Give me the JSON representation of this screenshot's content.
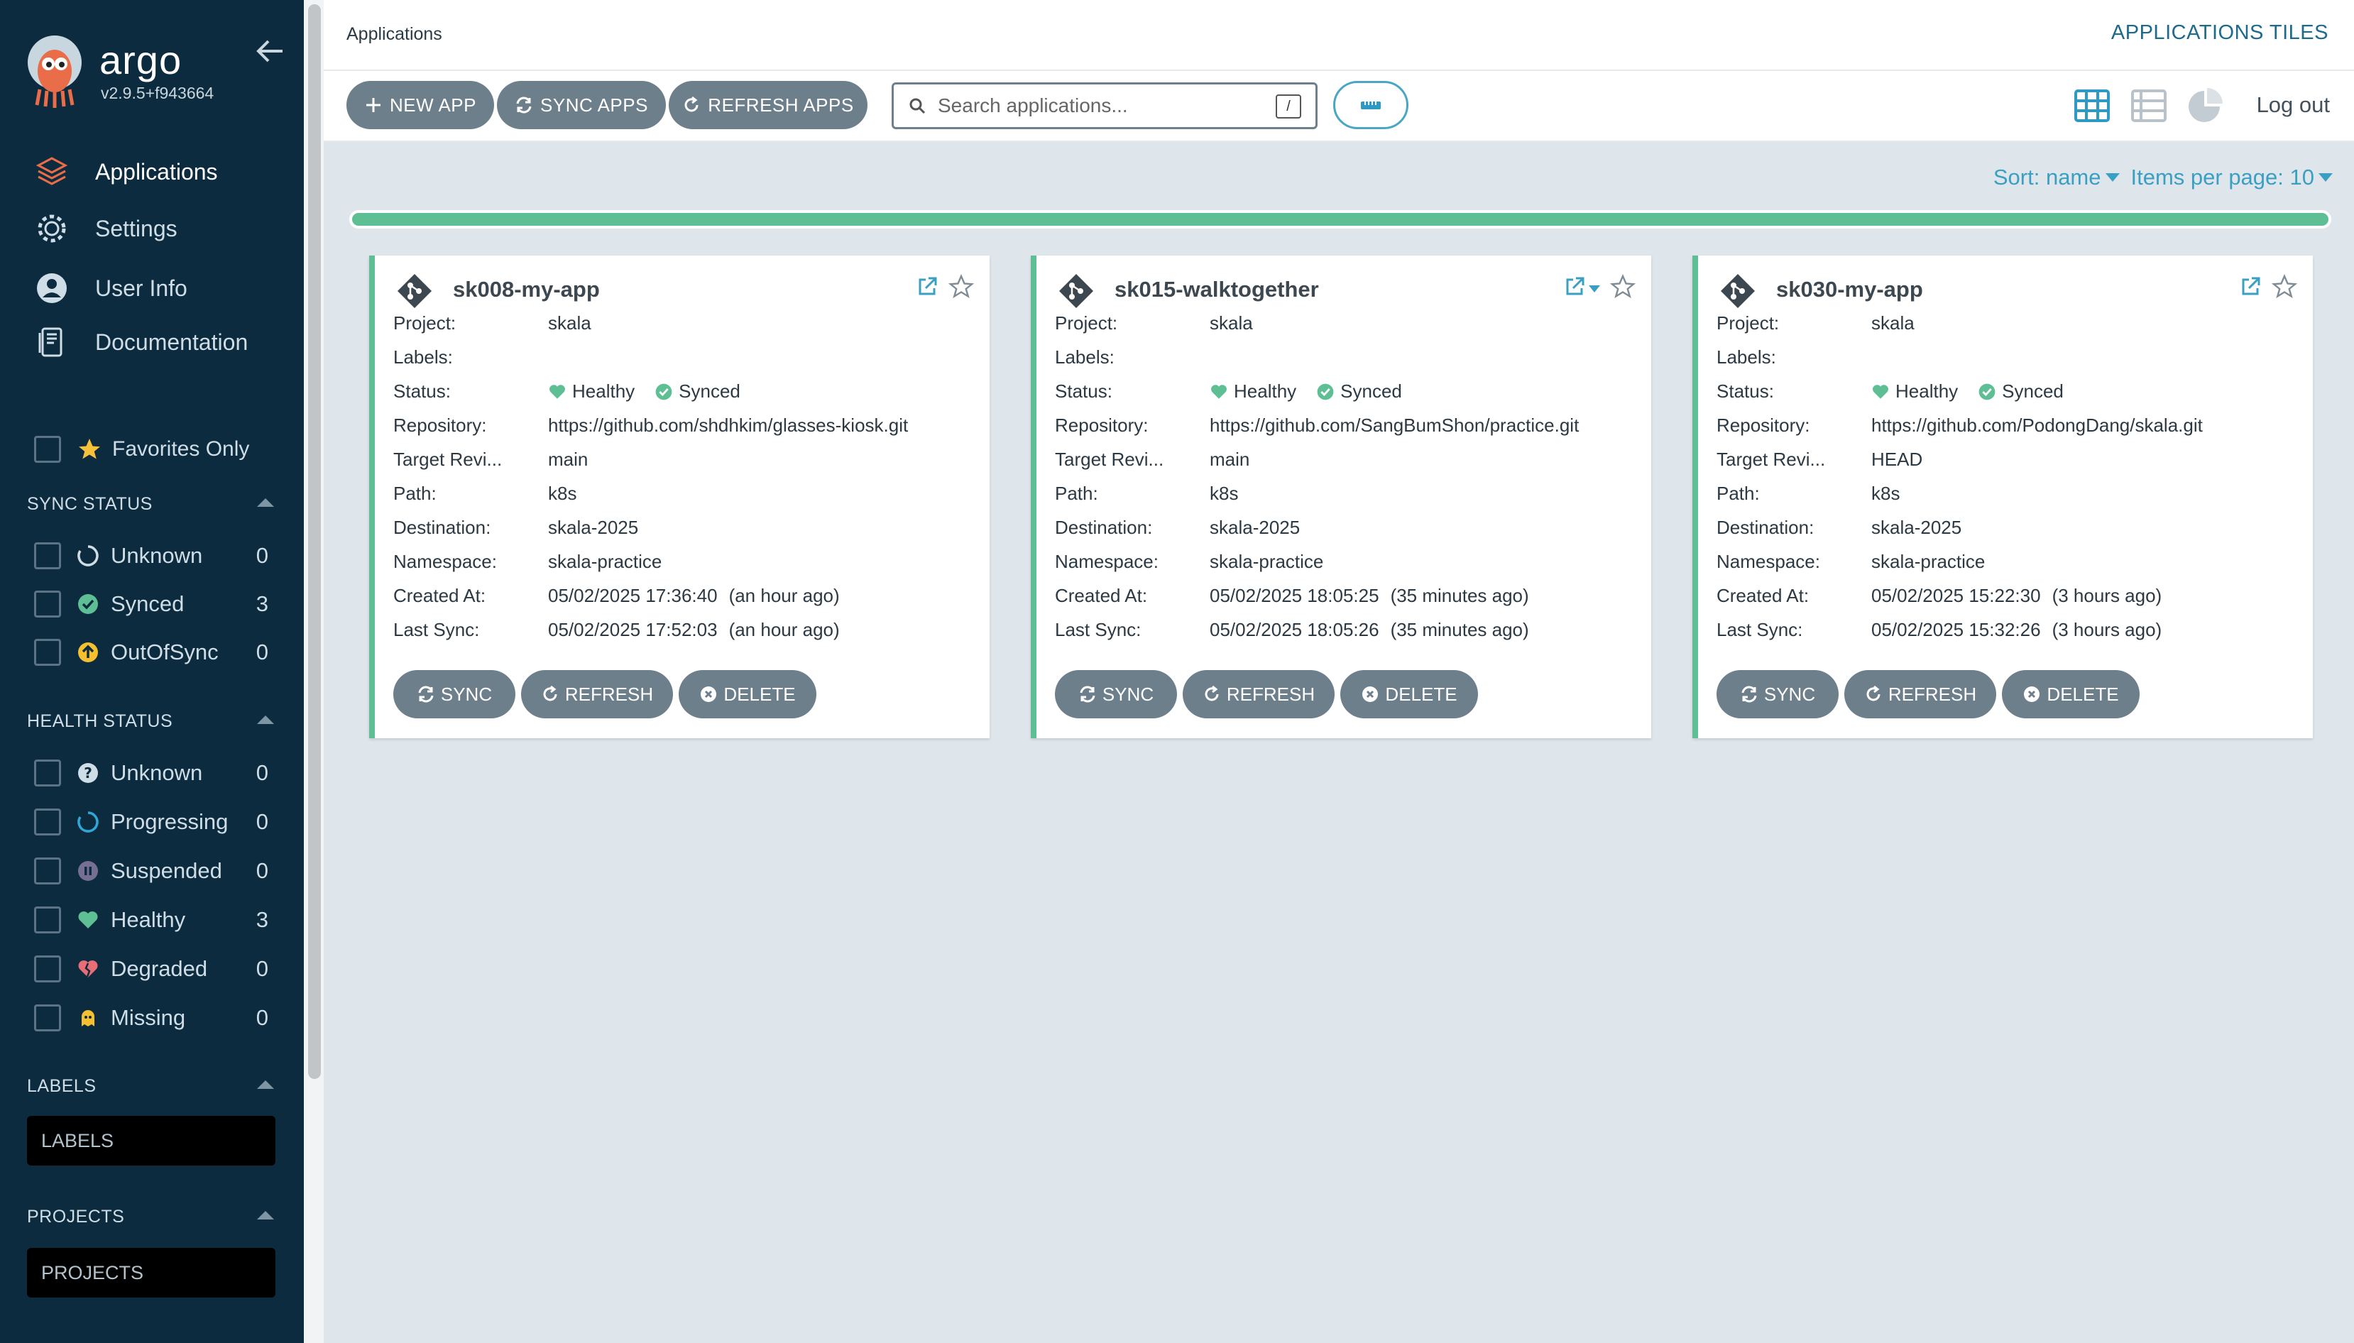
{
  "sidebar": {
    "brand": "argo",
    "version": "v2.9.5+f943664",
    "nav": [
      {
        "label": "Applications",
        "icon": "layers-icon"
      },
      {
        "label": "Settings",
        "icon": "gear-icon"
      },
      {
        "label": "User Info",
        "icon": "user-icon"
      },
      {
        "label": "Documentation",
        "icon": "book-icon"
      }
    ],
    "favorites_label": "Favorites Only",
    "sync_status": {
      "title": "SYNC STATUS",
      "items": [
        {
          "label": "Unknown",
          "count": "0"
        },
        {
          "label": "Synced",
          "count": "3"
        },
        {
          "label": "OutOfSync",
          "count": "0"
        }
      ]
    },
    "health_status": {
      "title": "HEALTH STATUS",
      "items": [
        {
          "label": "Unknown",
          "count": "0"
        },
        {
          "label": "Progressing",
          "count": "0"
        },
        {
          "label": "Suspended",
          "count": "0"
        },
        {
          "label": "Healthy",
          "count": "3"
        },
        {
          "label": "Degraded",
          "count": "0"
        },
        {
          "label": "Missing",
          "count": "0"
        }
      ]
    },
    "labels": {
      "title": "LABELS",
      "placeholder": "LABELS"
    },
    "projects": {
      "title": "PROJECTS",
      "placeholder": "PROJECTS"
    }
  },
  "header": {
    "breadcrumb": "Applications",
    "view_title": "APPLICATIONS TILES",
    "logout": "Log out"
  },
  "toolbar": {
    "new_app": "NEW APP",
    "sync_apps": "SYNC APPS",
    "refresh_apps": "REFRESH APPS",
    "search_placeholder": "Search applications...",
    "search_shortcut": "/"
  },
  "list": {
    "sort_label": "Sort: name",
    "per_page_label": "Items per page: 10",
    "progress_fraction": 1.0
  },
  "field_labels": {
    "project": "Project:",
    "labels": "Labels:",
    "status": "Status:",
    "repository": "Repository:",
    "target_revision": "Target Revi...",
    "path": "Path:",
    "destination": "Destination:",
    "namespace": "Namespace:",
    "created_at": "Created At:",
    "last_sync": "Last Sync:"
  },
  "card_buttons": {
    "sync": "SYNC",
    "refresh": "REFRESH",
    "delete": "DELETE"
  },
  "apps": [
    {
      "name": "sk008-my-app",
      "project": "skala",
      "labels": "",
      "health": "Healthy",
      "sync": "Synced",
      "repository": "https://github.com/shdhkim/glasses-kiosk.git",
      "target_revision": "main",
      "path": "k8s",
      "destination": "skala-2025",
      "namespace": "skala-practice",
      "created_at": "05/02/2025 17:36:40",
      "created_ago": "(an hour ago)",
      "last_sync": "05/02/2025 17:52:03",
      "last_sync_ago": "(an hour ago)"
    },
    {
      "name": "sk015-walktogether",
      "project": "skala",
      "labels": "",
      "health": "Healthy",
      "sync": "Synced",
      "repository": "https://github.com/SangBumShon/practice.git",
      "target_revision": "main",
      "path": "k8s",
      "destination": "skala-2025",
      "namespace": "skala-practice",
      "created_at": "05/02/2025 18:05:25",
      "created_ago": "(35 minutes ago)",
      "last_sync": "05/02/2025 18:05:26",
      "last_sync_ago": "(35 minutes ago)"
    },
    {
      "name": "sk030-my-app",
      "project": "skala",
      "labels": "",
      "health": "Healthy",
      "sync": "Synced",
      "repository": "https://github.com/PodongDang/skala.git",
      "target_revision": "HEAD",
      "path": "k8s",
      "destination": "skala-2025",
      "namespace": "skala-practice",
      "created_at": "05/02/2025 15:22:30",
      "created_ago": "(3 hours ago)",
      "last_sync": "05/02/2025 15:32:26",
      "last_sync_ago": "(3 hours ago)"
    }
  ],
  "colors": {
    "sidebar_bg": "#0d2b3e",
    "accent": "#3b9fc2",
    "healthy": "#5ebf95",
    "button": "#6d7f8b"
  }
}
